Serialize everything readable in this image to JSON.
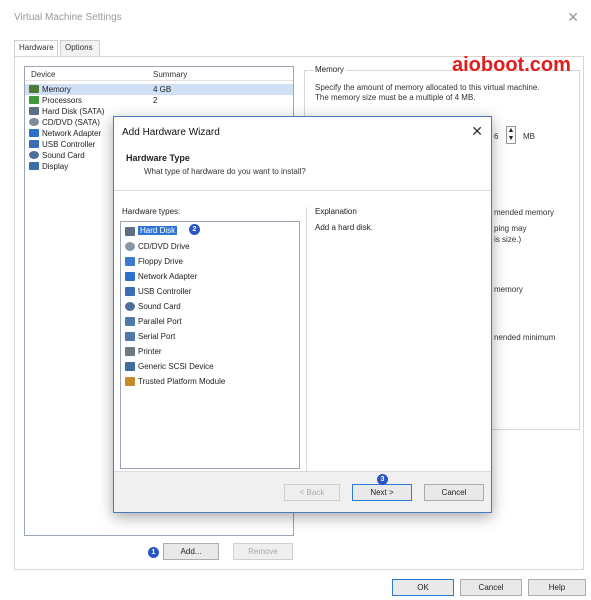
{
  "window": {
    "title": "Virtual Machine Settings",
    "close_glyph": "✕"
  },
  "tabs": [
    {
      "label": "Hardware"
    },
    {
      "label": "Options"
    }
  ],
  "device_list": {
    "columns": {
      "device": "Device",
      "summary": "Summary"
    },
    "rows": [
      {
        "device": "Memory",
        "summary": "4 GB",
        "icon": "memory-icon",
        "color": "#4d7b34"
      },
      {
        "device": "Processors",
        "summary": "2",
        "icon": "processor-icon",
        "color": "#3f9a3a"
      },
      {
        "device": "Hard Disk (SATA)",
        "summary": "",
        "icon": "hard-disk-icon",
        "color": "#5a6f86"
      },
      {
        "device": "CD/DVD (SATA)",
        "summary": "",
        "icon": "cd-dvd-icon",
        "color": "#7e8b98"
      },
      {
        "device": "Network Adapter",
        "summary": "",
        "icon": "network-adapter-icon",
        "color": "#2d70c9"
      },
      {
        "device": "USB Controller",
        "summary": "",
        "icon": "usb-icon",
        "color": "#3a6db3"
      },
      {
        "device": "Sound Card",
        "summary": "",
        "icon": "sound-card-icon",
        "color": "#4d6f9a"
      },
      {
        "device": "Display",
        "summary": "",
        "icon": "display-icon",
        "color": "#3b6faa"
      }
    ]
  },
  "device_buttons": {
    "add": "Add...",
    "remove": "Remove"
  },
  "badges": {
    "one": "1",
    "two": "2",
    "three": "3"
  },
  "memory_panel": {
    "legend": "Memory",
    "description": "Specify the amount of memory allocated to this virtual machine. The memory size must be a multiple of 4 MB.",
    "unit": "MB",
    "spinner_value_fragment": "6",
    "fragments": [
      "mended memory",
      "ping may",
      "is size.)",
      "memory",
      "nended minimum"
    ]
  },
  "watermark": "aioboot.com",
  "footer_buttons": {
    "ok": "OK",
    "cancel": "Cancel",
    "help": "Help"
  },
  "wizard": {
    "title": "Add Hardware Wizard",
    "close_glyph": "✕",
    "heading": "Hardware Type",
    "subheading": "What type of hardware do you want to install?",
    "types_label": "Hardware types:",
    "explanation_label": "Explanation",
    "explanation_text": "Add a hard disk.",
    "hardware_types": [
      {
        "label": "Hard Disk",
        "icon": "hard-disk-icon",
        "color": "#5a6f86"
      },
      {
        "label": "CD/DVD Drive",
        "icon": "cd-dvd-icon",
        "color": "#8a97a4"
      },
      {
        "label": "Floppy Drive",
        "icon": "floppy-icon",
        "color": "#3a7bd0"
      },
      {
        "label": "Network Adapter",
        "icon": "network-adapter-icon",
        "color": "#2d70c9"
      },
      {
        "label": "USB Controller",
        "icon": "usb-icon",
        "color": "#3a6db3"
      },
      {
        "label": "Sound Card",
        "icon": "sound-card-icon",
        "color": "#4d6f9a"
      },
      {
        "label": "Parallel Port",
        "icon": "parallel-port-icon",
        "color": "#4f79a8"
      },
      {
        "label": "Serial Port",
        "icon": "serial-port-icon",
        "color": "#4f79a8"
      },
      {
        "label": "Printer",
        "icon": "printer-icon",
        "color": "#6f7780"
      },
      {
        "label": "Generic SCSI Device",
        "icon": "scsi-icon",
        "color": "#3f6f9f"
      },
      {
        "label": "Trusted Platform Module",
        "icon": "tpm-icon",
        "color": "#c98a2a"
      }
    ],
    "buttons": {
      "back": "< Back",
      "next": "Next >",
      "cancel": "Cancel"
    }
  }
}
